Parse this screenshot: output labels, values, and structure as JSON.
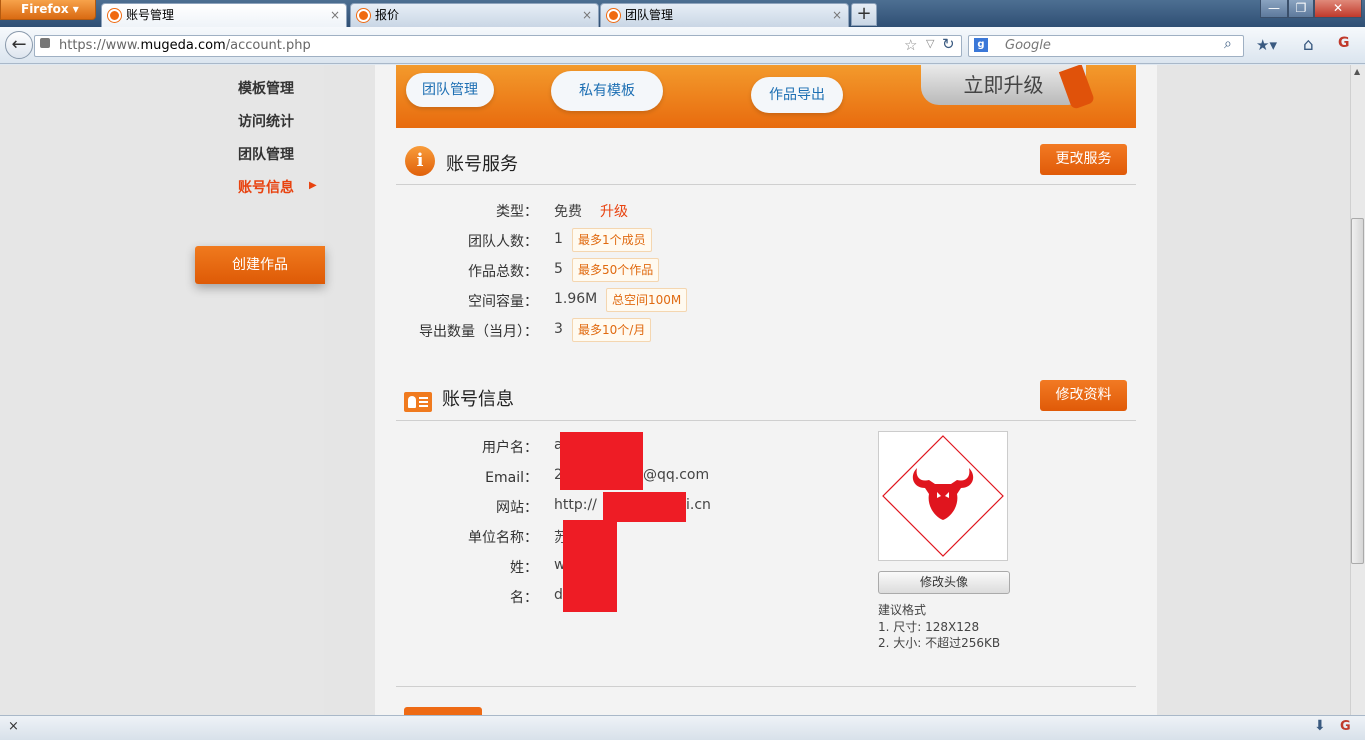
{
  "browser": {
    "menu_button": "Firefox",
    "tabs": [
      {
        "label": "账号管理",
        "close": "×"
      },
      {
        "label": "报价",
        "close": "×"
      },
      {
        "label": "团队管理",
        "close": "×"
      }
    ],
    "new_tab": "+",
    "url_prefix": "https://www.",
    "url_domain": "mugeda.com",
    "url_path": "/account.php",
    "search_placeholder": "Google",
    "window_buttons": [
      "—",
      "❐",
      "✕"
    ]
  },
  "sidebar": {
    "items": [
      {
        "label": "模板管理"
      },
      {
        "label": "访问统计"
      },
      {
        "label": "团队管理"
      },
      {
        "label": "账号信息"
      }
    ],
    "create_button": "创建作品"
  },
  "banner": {
    "clouds": [
      "团队管理",
      "私有模板",
      "作品导出"
    ],
    "upgrade": "立即升级"
  },
  "service": {
    "title": "账号服务",
    "change_button": "更改服务",
    "rows": [
      {
        "label": "类型：",
        "value": "免费",
        "extra": "升级"
      },
      {
        "label": "团队人数：",
        "value": "1",
        "tag": "最多1个成员"
      },
      {
        "label": "作品总数：",
        "value": "5",
        "tag": "最多50个作品"
      },
      {
        "label": "空间容量：",
        "value": "1.96M",
        "tag": "总空间100M"
      },
      {
        "label": "导出数量（当月）：",
        "value": "3",
        "tag": "最多10个/月"
      }
    ]
  },
  "account": {
    "title": "账号信息",
    "edit_button": "修改资料",
    "rows": [
      {
        "label": "用户名：",
        "value": "a"
      },
      {
        "label": "Email：",
        "value": "2",
        "suffix": "@qq.com"
      },
      {
        "label": "网站：",
        "value": "http://",
        "suffix": "i.cn"
      },
      {
        "label": "单位名称：",
        "value": "苏"
      },
      {
        "label": "姓：",
        "value": "w"
      },
      {
        "label": "名：",
        "value": "d"
      }
    ],
    "avatar_button": "修改头像",
    "hint_title": "建议格式",
    "hint_1": "1. 尺寸: 128X128",
    "hint_2": "2. 大小: 不超过256KB"
  },
  "colors": {
    "accent": "#e8420f",
    "button": "#e8620a",
    "redaction": "#ee1c25"
  }
}
